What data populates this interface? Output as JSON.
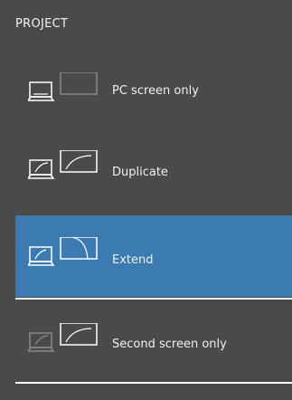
{
  "panel": {
    "title": "PROJECT",
    "options": [
      {
        "label": "PC screen only",
        "icon": "pc-screen-only-icon",
        "selected": false
      },
      {
        "label": "Duplicate",
        "icon": "duplicate-icon",
        "selected": false
      },
      {
        "label": "Extend",
        "icon": "extend-icon",
        "selected": true
      },
      {
        "label": "Second screen only",
        "icon": "second-screen-only-icon",
        "selected": false
      }
    ]
  },
  "colors": {
    "panel_bg": "#4a4a4a",
    "selected_bg": "#3b7bb2",
    "text": "#f0f0f0",
    "icon_stroke": "#ffffff",
    "icon_dim": "#8a8a8a"
  }
}
